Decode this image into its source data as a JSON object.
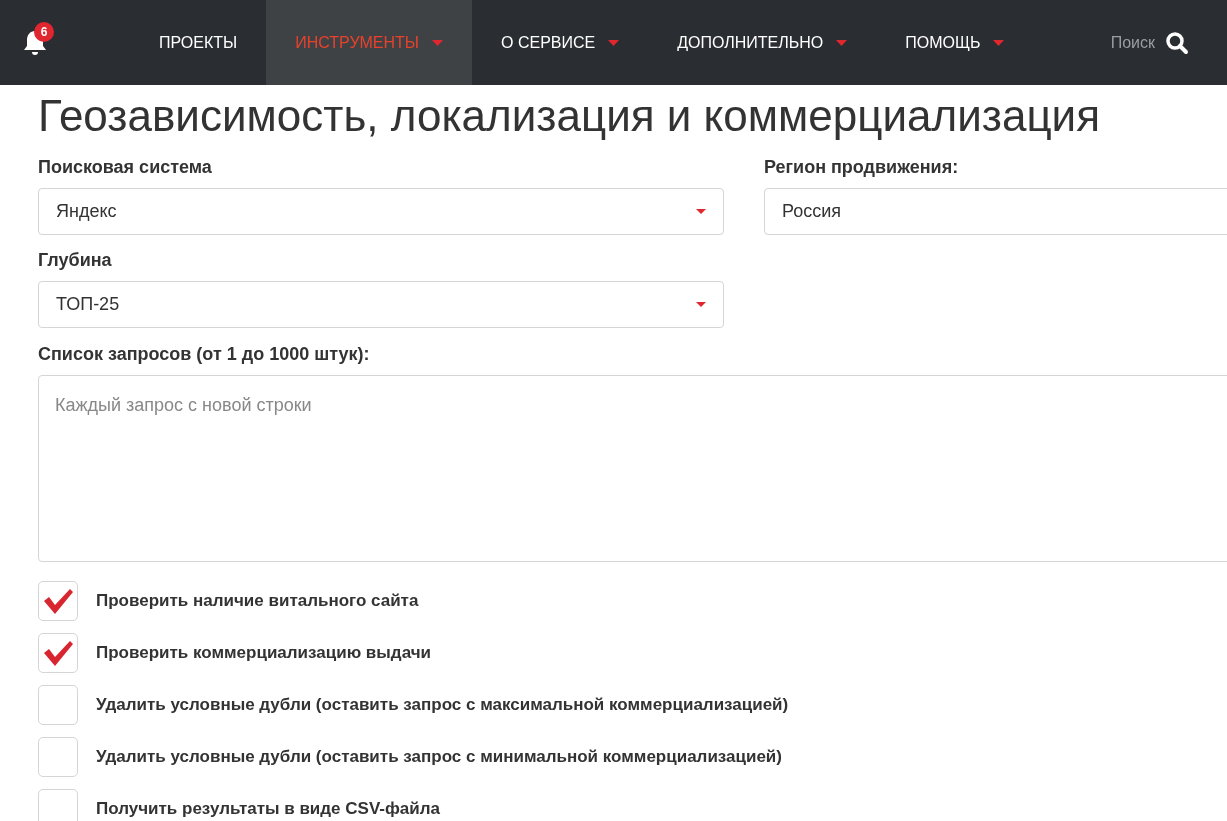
{
  "navbar": {
    "notifications": {
      "count": "6"
    },
    "items": [
      {
        "label": "ПРОЕКТЫ",
        "dropdown": false,
        "selected": false
      },
      {
        "label": "ИНСТРУМЕНТЫ",
        "dropdown": true,
        "selected": true
      },
      {
        "label": "О СЕРВИСЕ",
        "dropdown": true,
        "selected": false
      },
      {
        "label": "ДОПОЛНИТЕЛЬНО",
        "dropdown": true,
        "selected": false
      },
      {
        "label": "ПОМОЩЬ",
        "dropdown": true,
        "selected": false
      }
    ],
    "search": {
      "label": "Поиск"
    }
  },
  "page": {
    "title": "Геозависимость, локализация и коммерциализация",
    "search_engine": {
      "label": "Поисковая система",
      "value": "Яндекс"
    },
    "region": {
      "label": "Регион продвижения:",
      "value": "Россия"
    },
    "depth": {
      "label": "Глубина",
      "value": "ТОП-25"
    },
    "queries": {
      "label": "Список запросов (от 1 до 1000 штук):",
      "placeholder": "Каждый запрос с новой строки"
    },
    "options": [
      {
        "label": "Проверить наличие витального сайта",
        "checked": true
      },
      {
        "label": "Проверить коммерциализацию выдачи",
        "checked": true
      },
      {
        "label": "Удалить условные дубли (оставить запрос с максимальной коммерциализацией)",
        "checked": false
      },
      {
        "label": "Удалить условные дубли (оставить запрос с минимальной коммерциализацией)",
        "checked": false
      },
      {
        "label": "Получить результаты в виде CSV-файла",
        "checked": false
      }
    ]
  }
}
